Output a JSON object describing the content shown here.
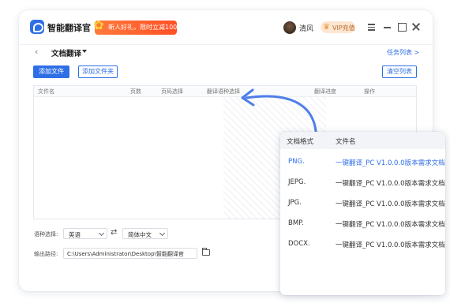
{
  "app": {
    "title": "智能翻译官"
  },
  "promo": {
    "text": "新人好礼，限时立减100元"
  },
  "user": {
    "name": "清风",
    "vip_label": "VIP充值"
  },
  "page": {
    "title": "文档翻译",
    "task_list": "任务列表 >"
  },
  "buttons": {
    "add_file": "添加文件",
    "add_folder": "添加文件夹",
    "clear_list": "清空列表"
  },
  "table": {
    "headers": [
      "文件名",
      "页数",
      "页码选择",
      "翻译语种选择",
      "翻译进度",
      "操作"
    ],
    "rows": []
  },
  "form": {
    "lang_label": "语种选择:",
    "source_lang": "英语",
    "target_lang": "简体中文",
    "output_label": "输出路径:",
    "output_path": "C:\\Users\\Administrator\\Desktop\\智能翻译官"
  },
  "popup": {
    "headers": [
      "文档格式",
      "文件名"
    ],
    "rows": [
      {
        "format": "PNG.",
        "name": "一键翻译_PC V1.0.0.0版本需求文档"
      },
      {
        "format": "JEPG.",
        "name": "一键翻译_PC V1.0.0.0版本需求文档"
      },
      {
        "format": "JPG.",
        "name": "一键翻译_PC V1.0.0.0版本需求文档"
      },
      {
        "format": "BMP.",
        "name": "一键翻译_PC V1.0.0.0版本需求文档"
      },
      {
        "format": "DOCX.",
        "name": "一键翻译_PC V1.0.0.0版本需求文档"
      }
    ],
    "active_color": "#2f6fe6"
  },
  "colors": {
    "accent": "#2f6fe6",
    "promo": "#ff5a2a",
    "vip_bg": "#fde7d3"
  },
  "icons": [
    "app-logo-icon",
    "gift-icon",
    "crown-icon",
    "menu-icon",
    "minimize-icon",
    "maximize-icon",
    "close-icon",
    "back-arrow-icon",
    "swap-icon",
    "folder-icon",
    "curved-arrow-icon"
  ]
}
